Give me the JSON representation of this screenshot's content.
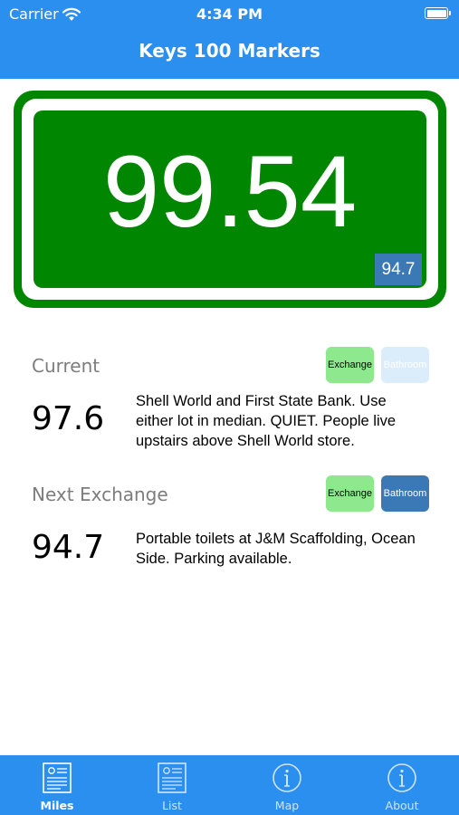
{
  "status_bar": {
    "carrier": "Carrier",
    "time": "4:34 PM"
  },
  "header": {
    "title": "Keys 100 Markers"
  },
  "sign": {
    "mile": "99.54",
    "next_exchange_badge": "94.7",
    "green": "#008600"
  },
  "current": {
    "title": "Current",
    "mile": "97.6",
    "exchange_label": "Exchange",
    "bathroom_label": "Bathroom",
    "exchange_available": true,
    "bathroom_available": false,
    "description": "Shell World and First State Bank. Use either lot in median. QUIET. People live upstairs above Shell World store."
  },
  "next_exchange": {
    "title": "Next Exchange",
    "mile": "94.7",
    "exchange_label": "Exchange",
    "bathroom_label": "Bathroom",
    "exchange_available": true,
    "bathroom_available": true,
    "description": "Portable toilets at J&M Scaffolding, Ocean Side. Parking available."
  },
  "tabs": [
    {
      "label": "Miles",
      "icon": "document-icon",
      "active": true
    },
    {
      "label": "List",
      "icon": "document-icon",
      "active": false
    },
    {
      "label": "Map",
      "icon": "info-icon",
      "active": false
    },
    {
      "label": "About",
      "icon": "info-icon",
      "active": false
    }
  ],
  "colors": {
    "brand_blue": "#2b8ff0",
    "exchange_green": "#8ee88e",
    "bathroom_blue": "#3a79b5",
    "bathroom_disabled": "#dbecfb"
  }
}
